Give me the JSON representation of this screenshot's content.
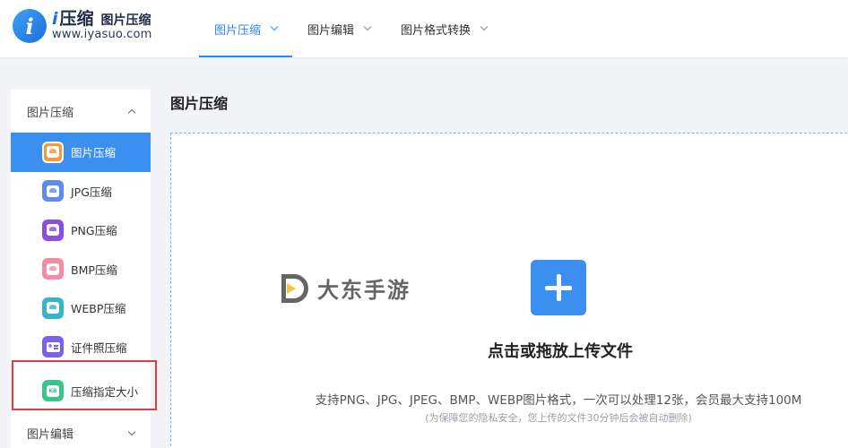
{
  "logo": {
    "mark": "i",
    "brand_i": "i",
    "brand_main": "压缩",
    "brand_sub": "图片压缩",
    "url": "www.iyasuo.com"
  },
  "nav": {
    "items": [
      {
        "label": "图片压缩",
        "active": true
      },
      {
        "label": "图片编辑",
        "active": false
      },
      {
        "label": "图片格式转换",
        "active": false
      }
    ]
  },
  "sidebar": {
    "group1": "图片压缩",
    "items": [
      {
        "label": "图片压缩",
        "icon": "image-compress-icon",
        "active": true
      },
      {
        "label": "JPG压缩",
        "icon": "jpg-icon",
        "active": false
      },
      {
        "label": "PNG压缩",
        "icon": "png-icon",
        "active": false
      },
      {
        "label": "BMP压缩",
        "icon": "bmp-icon",
        "active": false
      },
      {
        "label": "WEBP压缩",
        "icon": "webp-icon",
        "active": false
      },
      {
        "label": "证件照压缩",
        "icon": "id-photo-icon",
        "active": false
      },
      {
        "label": "压缩指定大小",
        "icon": "kb-size-icon",
        "active": false,
        "kb": "KB"
      }
    ],
    "group2": "图片编辑"
  },
  "main": {
    "title": "图片压缩",
    "upload_title": "点击或拖放上传文件",
    "upload_desc": "支持PNG、JPG、JPEG、BMP、WEBP图片格式，一次可以处理12张，会员最大支持100M",
    "upload_note": "(为保障您的隐私安全，您上传的文件30分钟后会被自动删除)"
  },
  "watermark": {
    "text": "大东手游"
  },
  "colors": {
    "accent": "#3a8ff0",
    "highlight_frame": "#e23b3b"
  }
}
